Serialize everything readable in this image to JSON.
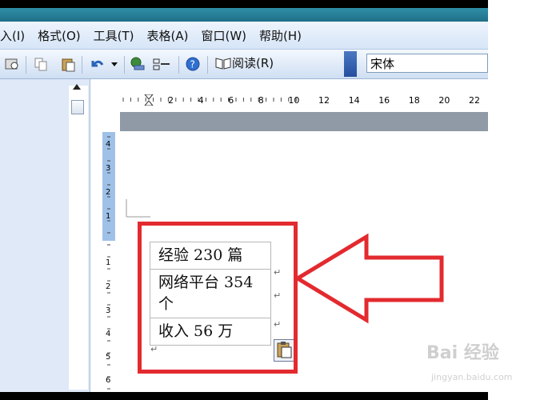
{
  "menubar": {
    "items": [
      "入(I)",
      "格式(O)",
      "工具(T)",
      "表格(A)",
      "窗口(W)",
      "帮助(H)"
    ]
  },
  "toolbar": {
    "read_label": "阅读(R)",
    "font_name": "宋体"
  },
  "ruler": {
    "corner": "L",
    "h_marks": [
      "2",
      "4",
      "6",
      "8",
      "10",
      "12",
      "14",
      "16",
      "18",
      "20",
      "22"
    ],
    "v_marks": [
      "4",
      "3",
      "2",
      "1",
      "1",
      "2",
      "3",
      "4",
      "5",
      "6"
    ]
  },
  "table": {
    "rows": [
      "经验 230 篇",
      "网络平台 354 个",
      "收入 56 万"
    ],
    "cell_mark": "↵"
  },
  "watermark": {
    "brand": "Bai 经验",
    "url": "jingyan.baidu.com"
  },
  "colors": {
    "highlight": "#e32a2f",
    "ruler_blue": "#9fc1e8"
  }
}
